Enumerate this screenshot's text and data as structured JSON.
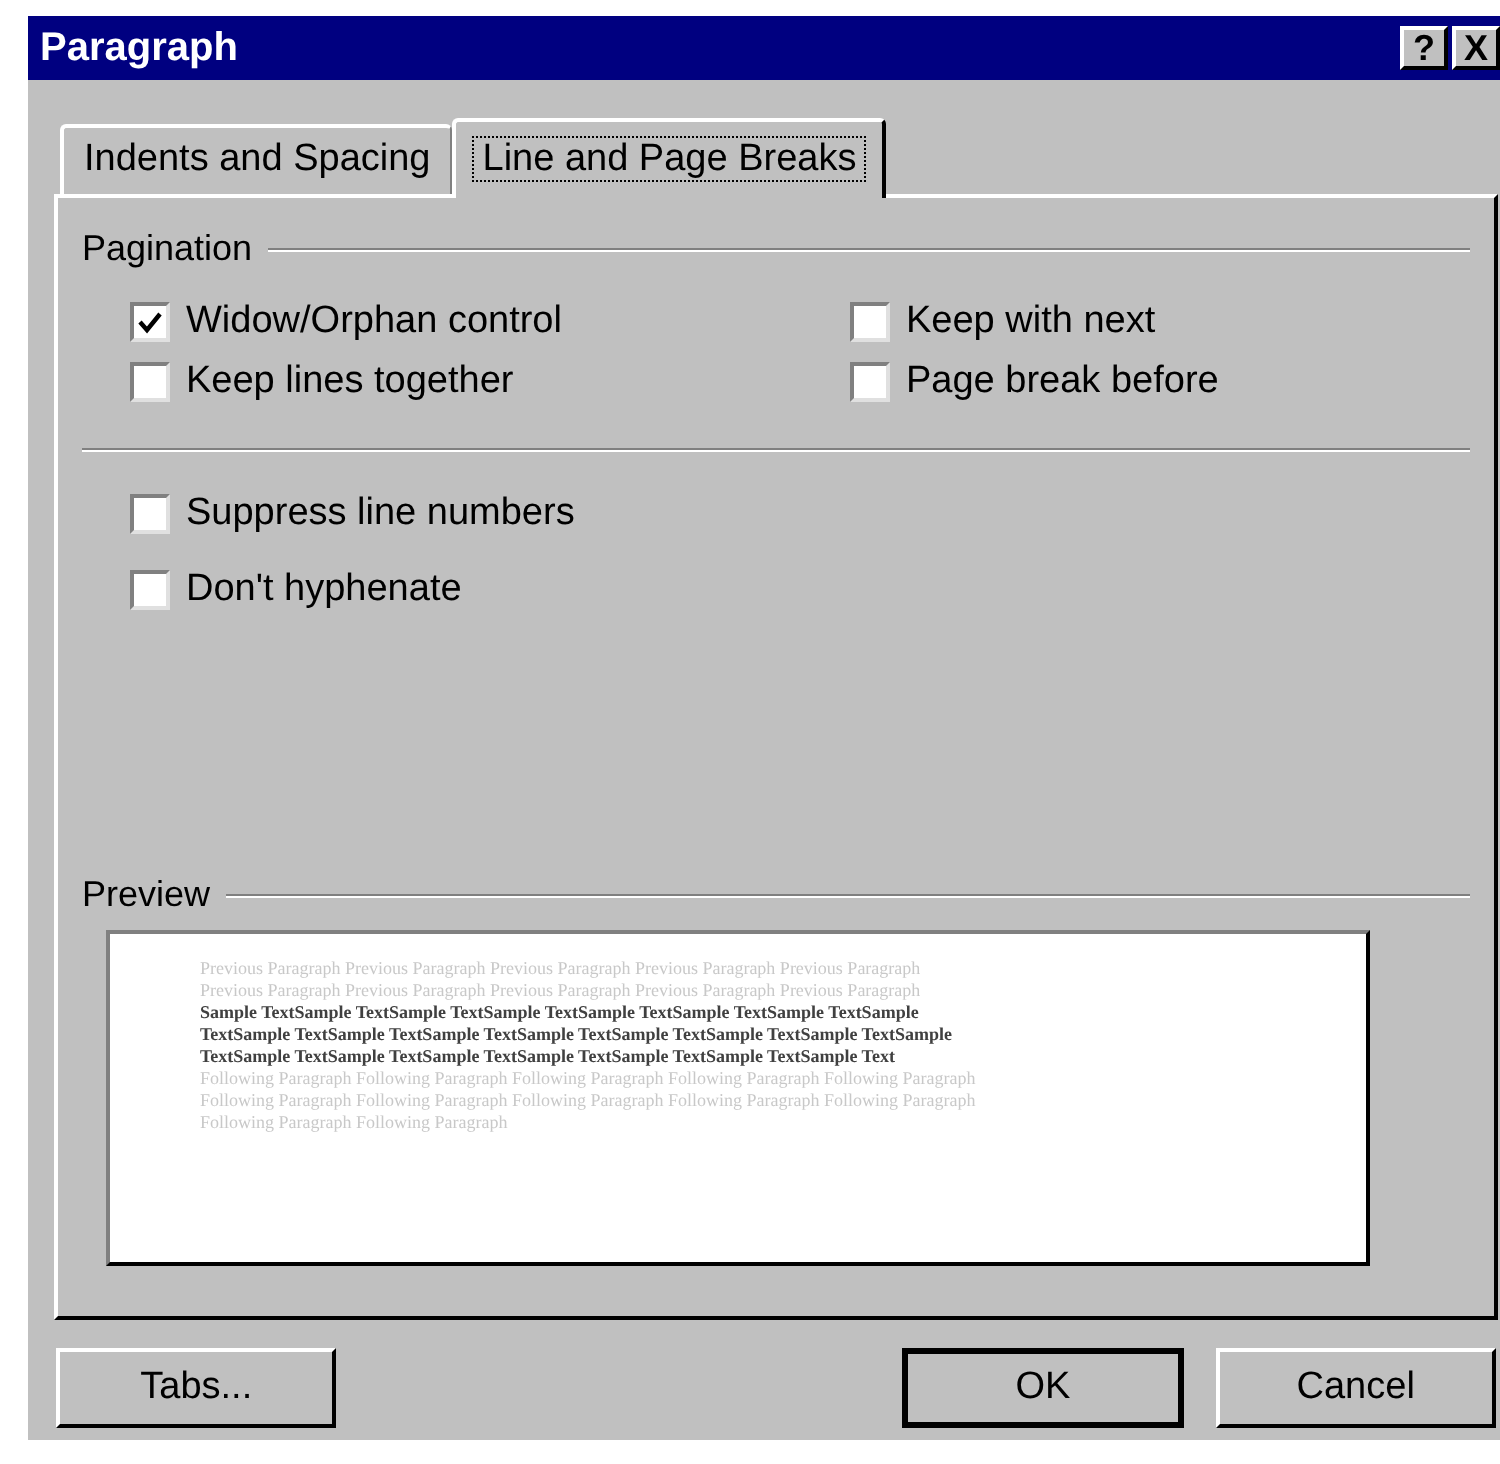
{
  "window": {
    "title": "Paragraph",
    "title_buttons": [
      "?",
      "X"
    ]
  },
  "tabs": [
    {
      "label": "Indents and Spacing",
      "selected": false
    },
    {
      "label": "Line and Page Breaks",
      "selected": true
    }
  ],
  "pagination": {
    "title": "Pagination",
    "options": [
      {
        "label": "Widow/Orphan control",
        "checked": true
      },
      {
        "label": "Keep with next",
        "checked": false
      },
      {
        "label": "Keep lines together",
        "checked": false
      },
      {
        "label": "Page break before",
        "checked": false
      }
    ]
  },
  "other_options": [
    {
      "label": "Suppress line numbers",
      "checked": false
    },
    {
      "label": "Don't hyphenate",
      "checked": false
    }
  ],
  "preview": {
    "title": "Preview",
    "lines": [
      {
        "kind": "previous",
        "text": "Previous Paragraph Previous Paragraph Previous Paragraph Previous Paragraph Previous Paragraph"
      },
      {
        "kind": "previous",
        "text": "Previous Paragraph Previous Paragraph Previous Paragraph Previous Paragraph Previous Paragraph"
      },
      {
        "kind": "sample",
        "text": "Sample TextSample TextSample TextSample TextSample TextSample TextSample TextSample"
      },
      {
        "kind": "sample",
        "text": "TextSample TextSample TextSample TextSample TextSample TextSample TextSample TextSample"
      },
      {
        "kind": "sample",
        "text": "TextSample TextSample TextSample TextSample TextSample TextSample TextSample Text"
      },
      {
        "kind": "following",
        "text": "Following Paragraph Following Paragraph Following Paragraph Following Paragraph Following Paragraph"
      },
      {
        "kind": "following",
        "text": "Following Paragraph Following Paragraph Following Paragraph Following Paragraph Following Paragraph"
      },
      {
        "kind": "following",
        "text": "Following Paragraph Following Paragraph"
      }
    ]
  },
  "buttons": [
    {
      "label": "Tabs...",
      "kind": "left",
      "default": false
    },
    {
      "label": "OK",
      "kind": "right",
      "default": true
    },
    {
      "label": "Cancel",
      "kind": "right",
      "default": false
    }
  ]
}
